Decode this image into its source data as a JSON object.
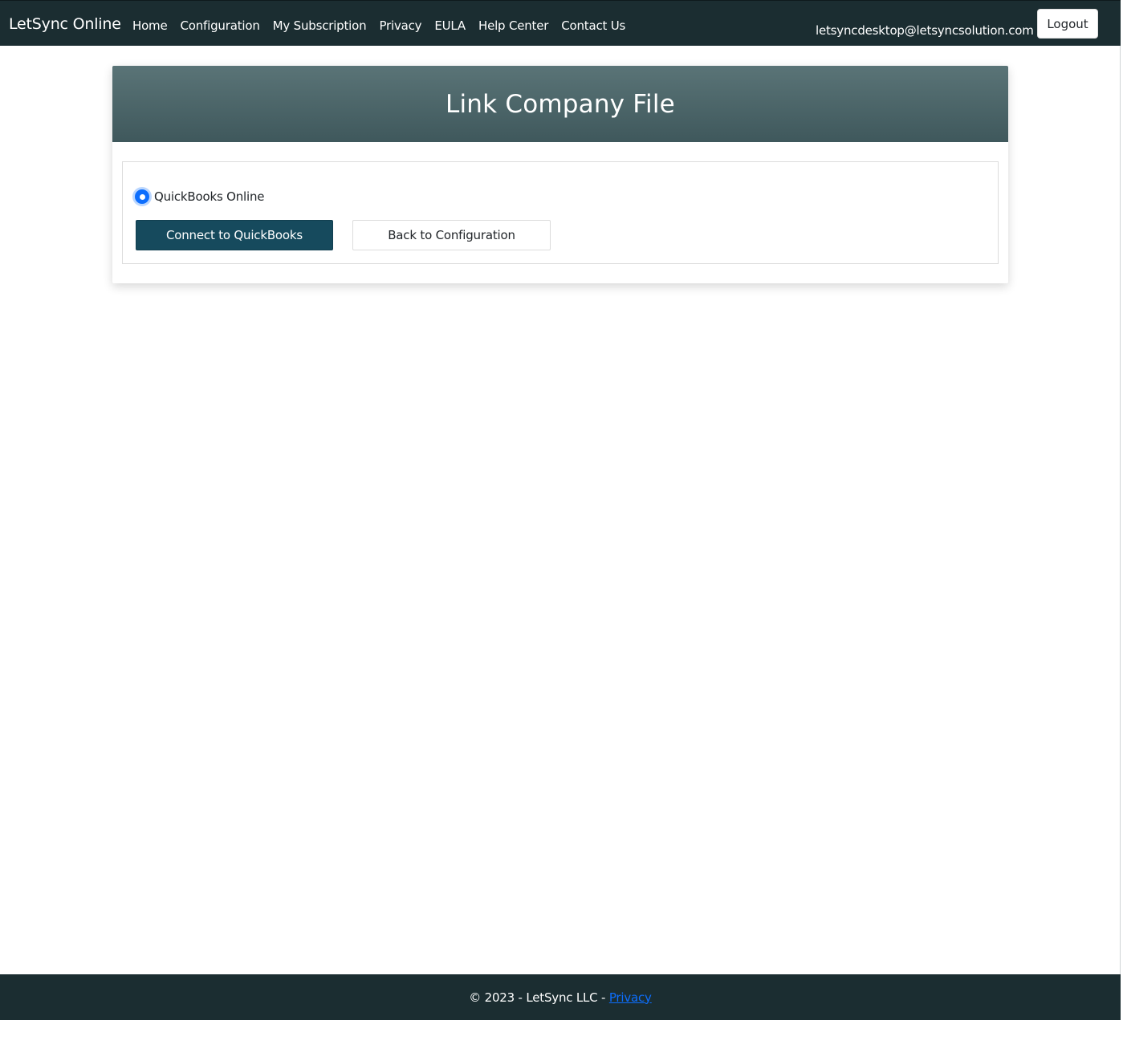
{
  "navbar": {
    "brand": "LetSync Online",
    "links": [
      {
        "label": "Home"
      },
      {
        "label": "Configuration"
      },
      {
        "label": "My Subscription"
      },
      {
        "label": "Privacy"
      },
      {
        "label": "EULA"
      },
      {
        "label": "Help Center"
      },
      {
        "label": "Contact Us"
      }
    ],
    "user_email": "letsyncdesktop@letsyncsolution.com",
    "logout_label": "Logout"
  },
  "card": {
    "title": "Link Company File",
    "radio_option": {
      "label": "QuickBooks Online",
      "selected": true
    },
    "connect_label": "Connect to QuickBooks",
    "back_label": "Back to Configuration"
  },
  "footer": {
    "text": "© 2023 - LetSync LLC - ",
    "link_label": "Privacy"
  },
  "colors": {
    "navbar_bg": "#1b2d31",
    "header_gradient_top": "#5a7477",
    "header_gradient_bottom": "#3f585c",
    "primary_button": "#164a5d",
    "radio_accent": "#0d6efd",
    "link": "#0d6efd"
  }
}
